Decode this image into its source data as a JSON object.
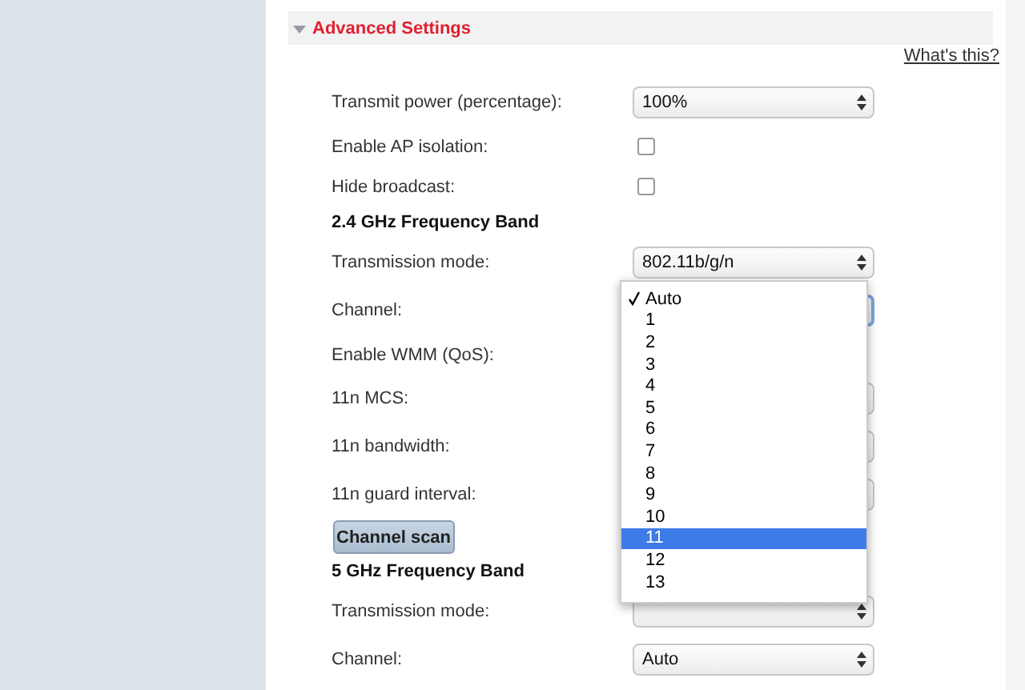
{
  "section": {
    "title": "Advanced Settings",
    "expanded": true
  },
  "help_link": "What's this?",
  "rows": [
    {
      "kind": "select",
      "label": "Transmit power (percentage):",
      "value": "100%"
    },
    {
      "kind": "checkbox",
      "label": "Enable AP isolation:",
      "checked": false
    },
    {
      "kind": "checkbox",
      "label": "Hide broadcast:",
      "checked": false
    },
    {
      "kind": "heading",
      "label": "2.4 GHz Frequency Band"
    },
    {
      "kind": "select",
      "label": "Transmission mode:",
      "value": "802.11b/g/n"
    },
    {
      "kind": "select",
      "label": "Channel:",
      "focused": true,
      "options": [
        {
          "label": "Auto",
          "checked": true,
          "selected": false
        },
        {
          "label": "1",
          "checked": false,
          "selected": false
        },
        {
          "label": "2",
          "checked": false,
          "selected": false
        },
        {
          "label": "3",
          "checked": false,
          "selected": false
        },
        {
          "label": "4",
          "checked": false,
          "selected": false
        },
        {
          "label": "5",
          "checked": false,
          "selected": false
        },
        {
          "label": "6",
          "checked": false,
          "selected": false
        },
        {
          "label": "7",
          "checked": false,
          "selected": false
        },
        {
          "label": "8",
          "checked": false,
          "selected": false
        },
        {
          "label": "9",
          "checked": false,
          "selected": false
        },
        {
          "label": "10",
          "checked": false,
          "selected": false
        },
        {
          "label": "11",
          "checked": false,
          "selected": true
        },
        {
          "label": "12",
          "checked": false,
          "selected": false
        },
        {
          "label": "13",
          "checked": false,
          "selected": false
        }
      ]
    },
    {
      "kind": "label",
      "label": "Enable WMM (QoS):"
    },
    {
      "kind": "select",
      "label": "11n MCS:"
    },
    {
      "kind": "select",
      "label": "11n bandwidth:"
    },
    {
      "kind": "select",
      "label": "11n guard interval:"
    },
    {
      "kind": "button",
      "label": "Channel scan"
    },
    {
      "kind": "heading",
      "label": "5 GHz Frequency Band"
    },
    {
      "kind": "select",
      "label": "Transmission mode:"
    },
    {
      "kind": "select",
      "label": "Channel:",
      "value": "Auto"
    }
  ]
}
